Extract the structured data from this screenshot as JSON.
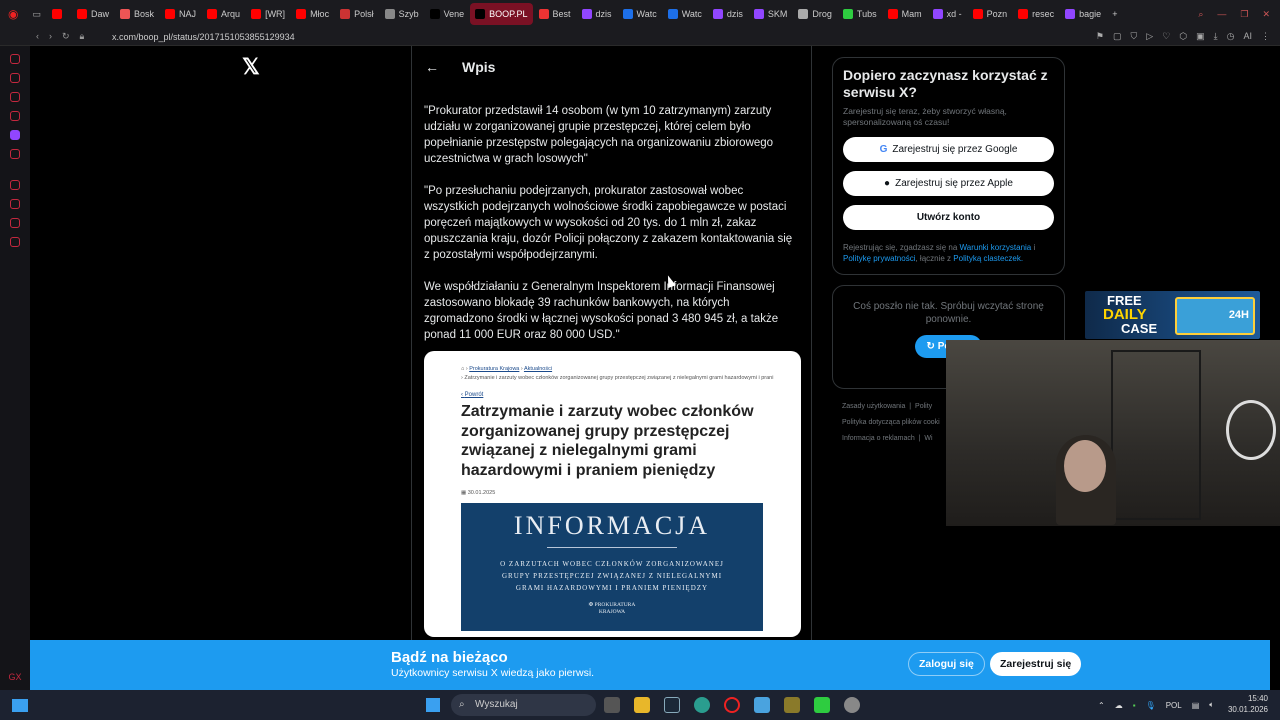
{
  "browser": {
    "tabs": [
      {
        "label": "",
        "color": "#ff0000"
      },
      {
        "label": "Daw",
        "color": "#ff0000"
      },
      {
        "label": "Bosk",
        "color": "#e55"
      },
      {
        "label": "NAJ",
        "color": "#ff0000"
      },
      {
        "label": "Arqu",
        "color": "#ff0000"
      },
      {
        "label": "[WR]",
        "color": "#ff0000"
      },
      {
        "label": "Młoc",
        "color": "#ff0000"
      },
      {
        "label": "Polsł",
        "color": "#c33"
      },
      {
        "label": "Szyb",
        "color": "#888"
      },
      {
        "label": "Vene",
        "color": "#000"
      },
      {
        "label": "BOOP.PL",
        "color": "#000",
        "active": true
      },
      {
        "label": "Best",
        "color": "#e33"
      },
      {
        "label": "dzis",
        "color": "#9146ff"
      },
      {
        "label": "Watc",
        "color": "#1d6fe8"
      },
      {
        "label": "Watc",
        "color": "#1d6fe8"
      },
      {
        "label": "dzis",
        "color": "#9146ff"
      },
      {
        "label": "SKM",
        "color": "#9146ff"
      },
      {
        "label": "Drog",
        "color": "#aaa"
      },
      {
        "label": "Tubs",
        "color": "#2ecc40"
      },
      {
        "label": "Mam",
        "color": "#ff0000"
      },
      {
        "label": "xd -",
        "color": "#9146ff"
      },
      {
        "label": "Pozn",
        "color": "#ff0000"
      },
      {
        "label": "resec",
        "color": "#ff0000"
      },
      {
        "label": "bagie",
        "color": "#9146ff"
      }
    ],
    "url": "x.com/boop_pl/status/2017151053855129934",
    "zoom_label": "AI"
  },
  "post": {
    "header_title": "Wpis",
    "paragraphs": [
      "\"Prokurator przedstawił 14 osobom (w tym 10 zatrzymanym) zarzuty udziału w zorganizowanej grupie przestępczej, której celem było popełnianie przestępstw polegających na organizowaniu zbiorowego uczestnictwa w grach losowych\"",
      "\"Po przesłuchaniu podejrzanych, prokurator zastosował wobec wszystkich podejrzanych wolnościowe środki zapobiegawcze w postaci poręczeń majątkowych w wysokości od 20 tys. do 1 mln zł, zakaz opuszczania kraju, dozór Policji połączony z zakazem kontaktowania się z pozostałymi współpodejrzanymi.",
      "We współdziałaniu z Generalnym Inspektorem Informacji Finansowej zastosowano blokadę 39 rachunków bankowych, na których zgromadzono środki w łącznej wysokości ponad 3 480 945 zł, a także ponad 11 000 EUR oraz 80 000 USD.\""
    ],
    "card": {
      "breadcrumb_1": "Prokuratura Krajowa",
      "breadcrumb_2": "Aktualności",
      "breadcrumb_3": "Zatrzymanie i zarzuty wobec członków zorganizowanej grupy przestępczej związanej z nielegalnymi grami hazardowymi i prani",
      "back_link": "Powrót",
      "title": "Zatrzymanie i zarzuty wobec członków zorganizowanej grupy przestępczej związanej z nielegalnymi grami hazardowymi i praniem pieniędzy",
      "date": "30.01.2025",
      "image_heading": "INFORMACJA",
      "image_sub_1": "O ZARZUTACH WOBEC CZŁONKÓW ZORGANIZOWANEJ",
      "image_sub_2": "GRUPY PRZESTĘPCZEJ ZWIĄZANEJ Z NIELEGALNYMI",
      "image_sub_3": "GRAMI HAZARDOWYMI I PRANIEM PIENIĘDZY",
      "image_org_1": "PROKURATURA",
      "image_org_2": "KRAJOWA"
    }
  },
  "signup": {
    "title": "Dopiero zaczynasz korzystać z serwisu X?",
    "subtitle": "Zarejestruj się teraz, żeby stworzyć własną, spersonalizowaną oś czasu!",
    "google_btn": "Zarejestruj się przez Google",
    "apple_btn": "Zarejestruj się przez Apple",
    "create_btn": "Utwórz konto",
    "terms_prefix": "Rejestrując się, zgadzasz się na",
    "terms_link": "Warunki korzystania",
    "terms_and": "i",
    "privacy_link": "Politykę prywatności",
    "cookies_prefix": ", łącznie z",
    "cookies_link": "Polityką clasteczek."
  },
  "error_box": {
    "text": "Coś poszło nie tak. Spróbuj wczytać stronę ponownie.",
    "retry": "Ponów"
  },
  "footer": {
    "l1a": "Zasady użytkowania",
    "l1b": "Polity",
    "l2": "Polityka dotycząca plików cooki",
    "l3a": "Informacja o reklamach",
    "l3b": "Wi"
  },
  "ad": {
    "t1": "FREE",
    "t2": "DAILY",
    "t3": "CASE",
    "badge": "24H"
  },
  "banner": {
    "title": "Bądź na bieżąco",
    "subtitle": "Użytkownicy serwisu X wiedzą jako pierwsi.",
    "login": "Zaloguj się",
    "register": "Zarejestruj się"
  },
  "taskbar": {
    "search_placeholder": "Wyszukaj",
    "lang": "POL",
    "time": "15:40",
    "date": "30.01.2026"
  },
  "sidebar_bottom": "GX"
}
